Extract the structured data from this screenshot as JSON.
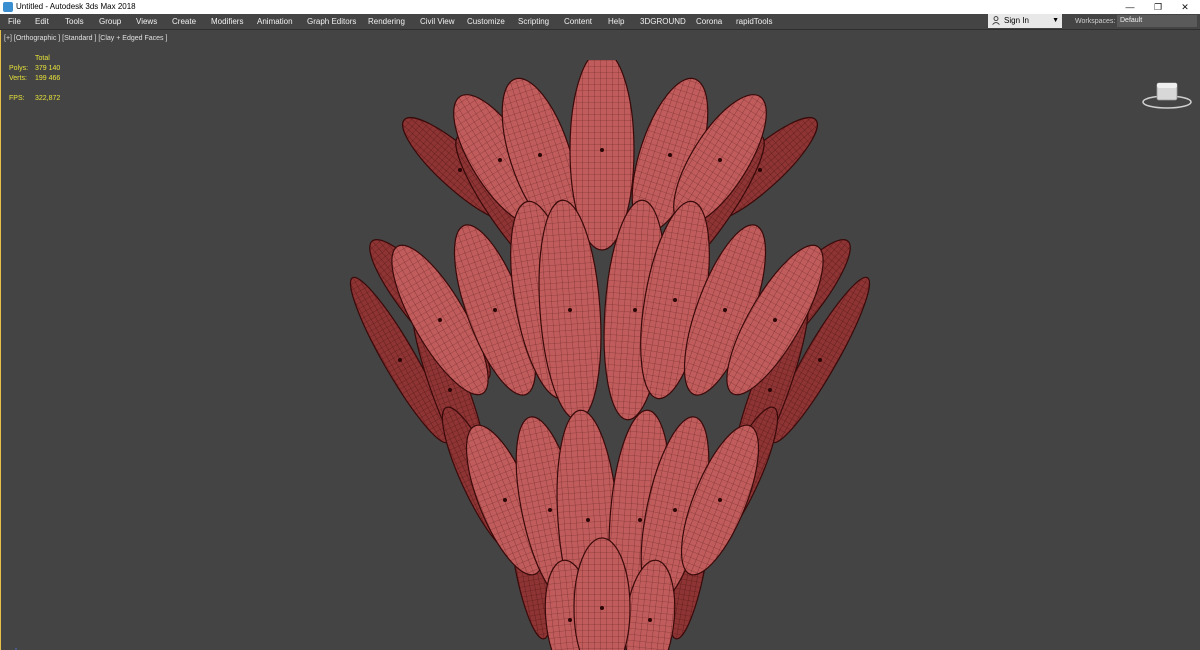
{
  "window": {
    "title": "Untitled - Autodesk 3ds Max 2018",
    "minimize": "—",
    "restore": "❐",
    "close": "✕"
  },
  "menu": {
    "items": [
      "File",
      "Edit",
      "Tools",
      "Group",
      "Views",
      "Create",
      "Modifiers",
      "Animation",
      "Graph Editors",
      "Rendering",
      "Civil View",
      "Customize",
      "Scripting",
      "Content",
      "Help",
      "3DGROUND",
      "Corona",
      "rapidTools"
    ],
    "signin_label": "Sign In",
    "workspaces_label": "Workspaces:",
    "workspaces_value": "Default"
  },
  "viewport": {
    "label": "[+] [Orthographic ] [Standard ] [Clay + Edged Faces ]",
    "stats": {
      "total_header": "Total",
      "polys_label": "Polys:",
      "polys_value": "379 140",
      "verts_label": "Verts:",
      "verts_value": "199 466",
      "fps_label": "FPS:",
      "fps_value": "322,872"
    }
  },
  "colors": {
    "viewport_bg": "#444444",
    "stats_text": "#e8e33a",
    "model_fill": "#b85454",
    "model_edge": "#3a0a0a",
    "active_border": "#e8c04a"
  }
}
